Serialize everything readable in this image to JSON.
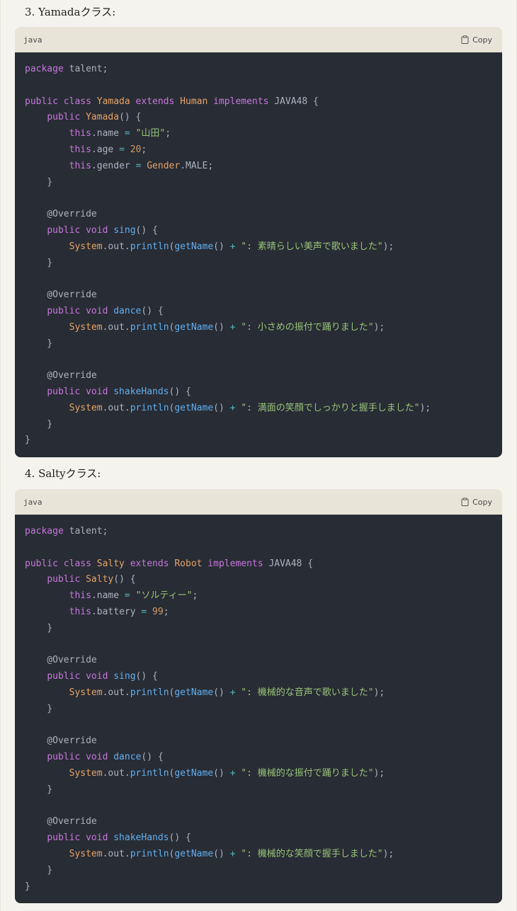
{
  "colors": {
    "page_bg": "#f5f3ed",
    "code_bg": "#282c34",
    "header_bg": "#e8e4d8",
    "keyword": "#c678dd",
    "class": "#e5a466",
    "function": "#61afef",
    "string": "#98c379",
    "number": "#d19a66",
    "operator": "#56b6c2",
    "plain": "#abb2bf"
  },
  "sections": [
    {
      "heading": "3. Yamadaクラス:",
      "code_block": {
        "language": "java",
        "copy_label": "Copy",
        "copy_icon": "clipboard-icon",
        "lines": [
          [
            {
              "t": "kw",
              "v": "package"
            },
            {
              "t": "plain",
              "v": " talent;"
            }
          ],
          [],
          [
            {
              "t": "kw",
              "v": "public class "
            },
            {
              "t": "cls",
              "v": "Yamada"
            },
            {
              "t": "kw",
              "v": " extends "
            },
            {
              "t": "cls",
              "v": "Human"
            },
            {
              "t": "kw",
              "v": " implements "
            },
            {
              "t": "plain",
              "v": "JAVA48 {"
            }
          ],
          [
            {
              "t": "plain",
              "v": "    "
            },
            {
              "t": "kw",
              "v": "public "
            },
            {
              "t": "cls",
              "v": "Yamada"
            },
            {
              "t": "plain",
              "v": "() {"
            }
          ],
          [
            {
              "t": "plain",
              "v": "        "
            },
            {
              "t": "kw",
              "v": "this"
            },
            {
              "t": "plain",
              "v": ".name "
            },
            {
              "t": "op",
              "v": "="
            },
            {
              "t": "plain",
              "v": " "
            },
            {
              "t": "str",
              "v": "\"山田\""
            },
            {
              "t": "plain",
              "v": ";"
            }
          ],
          [
            {
              "t": "plain",
              "v": "        "
            },
            {
              "t": "kw",
              "v": "this"
            },
            {
              "t": "plain",
              "v": ".age "
            },
            {
              "t": "op",
              "v": "="
            },
            {
              "t": "plain",
              "v": " "
            },
            {
              "t": "num",
              "v": "20"
            },
            {
              "t": "plain",
              "v": ";"
            }
          ],
          [
            {
              "t": "plain",
              "v": "        "
            },
            {
              "t": "kw",
              "v": "this"
            },
            {
              "t": "plain",
              "v": ".gender "
            },
            {
              "t": "op",
              "v": "="
            },
            {
              "t": "plain",
              "v": " "
            },
            {
              "t": "cls",
              "v": "Gender"
            },
            {
              "t": "plain",
              "v": ".MALE;"
            }
          ],
          [
            {
              "t": "plain",
              "v": "    }"
            }
          ],
          [],
          [
            {
              "t": "plain",
              "v": "    @Override"
            }
          ],
          [
            {
              "t": "plain",
              "v": "    "
            },
            {
              "t": "kw",
              "v": "public void "
            },
            {
              "t": "fn",
              "v": "sing"
            },
            {
              "t": "plain",
              "v": "() {"
            }
          ],
          [
            {
              "t": "plain",
              "v": "        "
            },
            {
              "t": "cls",
              "v": "System"
            },
            {
              "t": "plain",
              "v": ".out."
            },
            {
              "t": "fn",
              "v": "println"
            },
            {
              "t": "plain",
              "v": "("
            },
            {
              "t": "fn",
              "v": "getName"
            },
            {
              "t": "plain",
              "v": "() "
            },
            {
              "t": "op",
              "v": "+"
            },
            {
              "t": "plain",
              "v": " "
            },
            {
              "t": "str",
              "v": "\": 素晴らしい美声で歌いました\""
            },
            {
              "t": "plain",
              "v": ");"
            }
          ],
          [
            {
              "t": "plain",
              "v": "    }"
            }
          ],
          [],
          [
            {
              "t": "plain",
              "v": "    @Override"
            }
          ],
          [
            {
              "t": "plain",
              "v": "    "
            },
            {
              "t": "kw",
              "v": "public void "
            },
            {
              "t": "fn",
              "v": "dance"
            },
            {
              "t": "plain",
              "v": "() {"
            }
          ],
          [
            {
              "t": "plain",
              "v": "        "
            },
            {
              "t": "cls",
              "v": "System"
            },
            {
              "t": "plain",
              "v": ".out."
            },
            {
              "t": "fn",
              "v": "println"
            },
            {
              "t": "plain",
              "v": "("
            },
            {
              "t": "fn",
              "v": "getName"
            },
            {
              "t": "plain",
              "v": "() "
            },
            {
              "t": "op",
              "v": "+"
            },
            {
              "t": "plain",
              "v": " "
            },
            {
              "t": "str",
              "v": "\": 小さめの振付で踊りました\""
            },
            {
              "t": "plain",
              "v": ");"
            }
          ],
          [
            {
              "t": "plain",
              "v": "    }"
            }
          ],
          [],
          [
            {
              "t": "plain",
              "v": "    @Override"
            }
          ],
          [
            {
              "t": "plain",
              "v": "    "
            },
            {
              "t": "kw",
              "v": "public void "
            },
            {
              "t": "fn",
              "v": "shakeHands"
            },
            {
              "t": "plain",
              "v": "() {"
            }
          ],
          [
            {
              "t": "plain",
              "v": "        "
            },
            {
              "t": "cls",
              "v": "System"
            },
            {
              "t": "plain",
              "v": ".out."
            },
            {
              "t": "fn",
              "v": "println"
            },
            {
              "t": "plain",
              "v": "("
            },
            {
              "t": "fn",
              "v": "getName"
            },
            {
              "t": "plain",
              "v": "() "
            },
            {
              "t": "op",
              "v": "+"
            },
            {
              "t": "plain",
              "v": " "
            },
            {
              "t": "str",
              "v": "\": 満面の笑顔でしっかりと握手しました\""
            },
            {
              "t": "plain",
              "v": ");"
            }
          ],
          [
            {
              "t": "plain",
              "v": "    }"
            }
          ],
          [
            {
              "t": "plain",
              "v": "}"
            }
          ]
        ]
      }
    },
    {
      "heading": "4. Saltyクラス:",
      "code_block": {
        "language": "java",
        "copy_label": "Copy",
        "copy_icon": "clipboard-icon",
        "lines": [
          [
            {
              "t": "kw",
              "v": "package"
            },
            {
              "t": "plain",
              "v": " talent;"
            }
          ],
          [],
          [
            {
              "t": "kw",
              "v": "public class "
            },
            {
              "t": "cls",
              "v": "Salty"
            },
            {
              "t": "kw",
              "v": " extends "
            },
            {
              "t": "cls",
              "v": "Robot"
            },
            {
              "t": "kw",
              "v": " implements "
            },
            {
              "t": "plain",
              "v": "JAVA48 {"
            }
          ],
          [
            {
              "t": "plain",
              "v": "    "
            },
            {
              "t": "kw",
              "v": "public "
            },
            {
              "t": "cls",
              "v": "Salty"
            },
            {
              "t": "plain",
              "v": "() {"
            }
          ],
          [
            {
              "t": "plain",
              "v": "        "
            },
            {
              "t": "kw",
              "v": "this"
            },
            {
              "t": "plain",
              "v": ".name "
            },
            {
              "t": "op",
              "v": "="
            },
            {
              "t": "plain",
              "v": " "
            },
            {
              "t": "str",
              "v": "\"ソルティー\""
            },
            {
              "t": "plain",
              "v": ";"
            }
          ],
          [
            {
              "t": "plain",
              "v": "        "
            },
            {
              "t": "kw",
              "v": "this"
            },
            {
              "t": "plain",
              "v": ".battery "
            },
            {
              "t": "op",
              "v": "="
            },
            {
              "t": "plain",
              "v": " "
            },
            {
              "t": "num",
              "v": "99"
            },
            {
              "t": "plain",
              "v": ";"
            }
          ],
          [
            {
              "t": "plain",
              "v": "    }"
            }
          ],
          [],
          [
            {
              "t": "plain",
              "v": "    @Override"
            }
          ],
          [
            {
              "t": "plain",
              "v": "    "
            },
            {
              "t": "kw",
              "v": "public void "
            },
            {
              "t": "fn",
              "v": "sing"
            },
            {
              "t": "plain",
              "v": "() {"
            }
          ],
          [
            {
              "t": "plain",
              "v": "        "
            },
            {
              "t": "cls",
              "v": "System"
            },
            {
              "t": "plain",
              "v": ".out."
            },
            {
              "t": "fn",
              "v": "println"
            },
            {
              "t": "plain",
              "v": "("
            },
            {
              "t": "fn",
              "v": "getName"
            },
            {
              "t": "plain",
              "v": "() "
            },
            {
              "t": "op",
              "v": "+"
            },
            {
              "t": "plain",
              "v": " "
            },
            {
              "t": "str",
              "v": "\": 機械的な音声で歌いました\""
            },
            {
              "t": "plain",
              "v": ");"
            }
          ],
          [
            {
              "t": "plain",
              "v": "    }"
            }
          ],
          [],
          [
            {
              "t": "plain",
              "v": "    @Override"
            }
          ],
          [
            {
              "t": "plain",
              "v": "    "
            },
            {
              "t": "kw",
              "v": "public void "
            },
            {
              "t": "fn",
              "v": "dance"
            },
            {
              "t": "plain",
              "v": "() {"
            }
          ],
          [
            {
              "t": "plain",
              "v": "        "
            },
            {
              "t": "cls",
              "v": "System"
            },
            {
              "t": "plain",
              "v": ".out."
            },
            {
              "t": "fn",
              "v": "println"
            },
            {
              "t": "plain",
              "v": "("
            },
            {
              "t": "fn",
              "v": "getName"
            },
            {
              "t": "plain",
              "v": "() "
            },
            {
              "t": "op",
              "v": "+"
            },
            {
              "t": "plain",
              "v": " "
            },
            {
              "t": "str",
              "v": "\": 機械的な振付で踊りました\""
            },
            {
              "t": "plain",
              "v": ");"
            }
          ],
          [
            {
              "t": "plain",
              "v": "    }"
            }
          ],
          [],
          [
            {
              "t": "plain",
              "v": "    @Override"
            }
          ],
          [
            {
              "t": "plain",
              "v": "    "
            },
            {
              "t": "kw",
              "v": "public void "
            },
            {
              "t": "fn",
              "v": "shakeHands"
            },
            {
              "t": "plain",
              "v": "() {"
            }
          ],
          [
            {
              "t": "plain",
              "v": "        "
            },
            {
              "t": "cls",
              "v": "System"
            },
            {
              "t": "plain",
              "v": ".out."
            },
            {
              "t": "fn",
              "v": "println"
            },
            {
              "t": "plain",
              "v": "("
            },
            {
              "t": "fn",
              "v": "getName"
            },
            {
              "t": "plain",
              "v": "() "
            },
            {
              "t": "op",
              "v": "+"
            },
            {
              "t": "plain",
              "v": " "
            },
            {
              "t": "str",
              "v": "\": 機械的な笑顔で握手しました\""
            },
            {
              "t": "plain",
              "v": ");"
            }
          ],
          [
            {
              "t": "plain",
              "v": "    }"
            }
          ],
          [
            {
              "t": "plain",
              "v": "}"
            }
          ]
        ]
      }
    }
  ]
}
